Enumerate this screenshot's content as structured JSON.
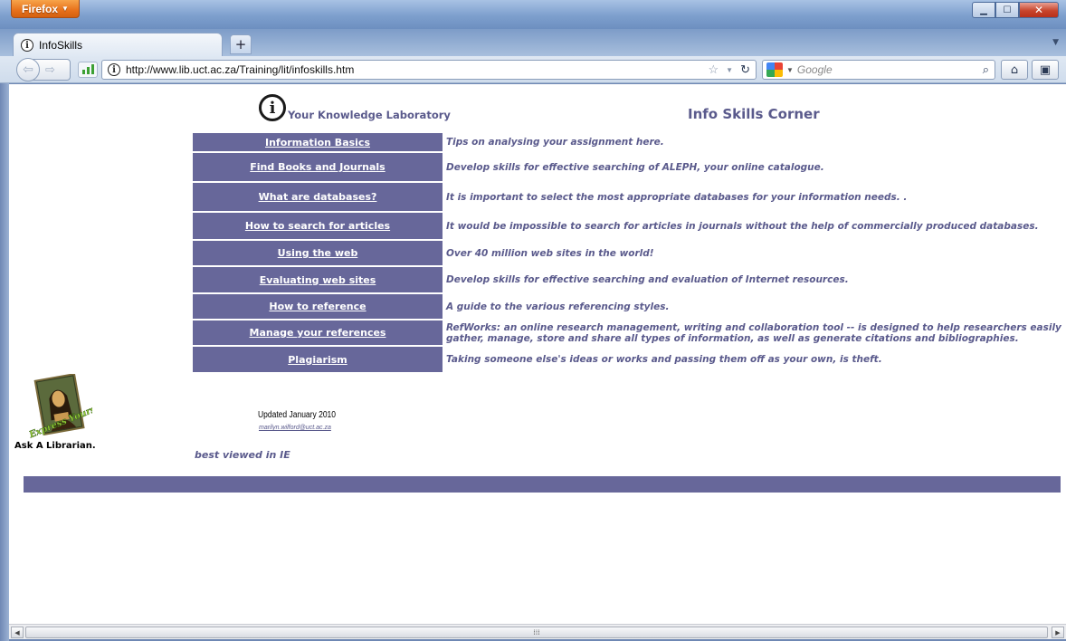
{
  "browser": {
    "menu_button": "Firefox",
    "tab_title": "InfoSkills",
    "new_tab": "+",
    "url": "http://www.lib.uct.ac.za/Training/lit/infoskills.htm",
    "search_placeholder": "Google"
  },
  "page": {
    "logo_text": "Your Knowledge Laboratory",
    "title": "Info Skills Corner",
    "menu": [
      {
        "label": "Information Basics",
        "desc": "Tips on analysing your assignment here."
      },
      {
        "label": "Find Books and Journals",
        "desc": "Develop skills for effective searching of ALEPH, your online catalogue."
      },
      {
        "label": "What are databases?",
        "desc": "It is important to select the most appropriate databases for your information needs. ."
      },
      {
        "label": "How to search for articles",
        "desc": "It would be impossible to search for articles in journals without the help of commercially produced databases."
      },
      {
        "label": "Using the web",
        "desc": "Over 40 million web sites in the world!"
      },
      {
        "label": "Evaluating web sites",
        "desc": "Develop skills for effective searching and evaluation of Internet resources."
      },
      {
        "label": "How to reference",
        "desc": "A guide to the various referencing styles."
      },
      {
        "label": "Manage your references",
        "desc": "RefWorks:  an online research management, writing and collaboration tool -- is designed to help researchers easily gather, manage, store and share all types of information, as well as generate citations and bibliographies."
      },
      {
        "label": "Plagiarism",
        "desc": "Taking someone else's ideas or works and passing them off as your own, is theft."
      }
    ],
    "ask_librarian": "Ask A Librarian.",
    "mona_caption": "Express Yourself!",
    "updated": "Updated January 2010",
    "email": "marilyn.wilford@uct.ac.za",
    "best_viewed": "best viewed in IE"
  },
  "colors": {
    "accent": "#67679a",
    "text_accent": "#5a5a8c"
  }
}
